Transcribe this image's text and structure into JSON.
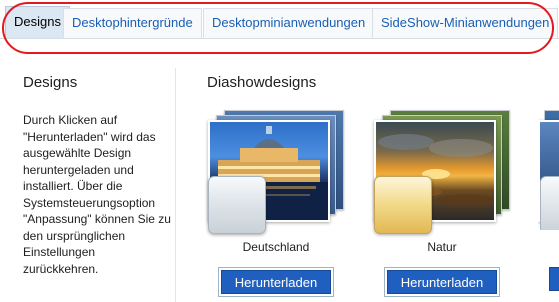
{
  "tabs": [
    {
      "label": "Designs",
      "active": true
    },
    {
      "label": "Desktophintergründe",
      "active": false
    },
    {
      "label": "Desktopminianwendungen",
      "active": false
    },
    {
      "label": "SideShow-Minianwendungen",
      "active": false
    }
  ],
  "sidebar": {
    "title": "Designs",
    "description": "Durch Klicken auf \"Herunterladen\" wird das ausgewählte Design heruntergeladen und installiert. Über die Systemsteuerungsoption \"Anpassung\" können Sie zu den ursprünglichen Einstellungen zurückkehren."
  },
  "main": {
    "title": "Diashowdesigns",
    "themes": [
      {
        "name": "Deutschland",
        "button_label": "Herunterladen"
      },
      {
        "name": "Natur",
        "button_label": "Herunterladen"
      }
    ]
  },
  "colors": {
    "accent": "#1f5fbf",
    "highlight_ring": "#e2191e",
    "tab_active": "#dbe7f3"
  }
}
